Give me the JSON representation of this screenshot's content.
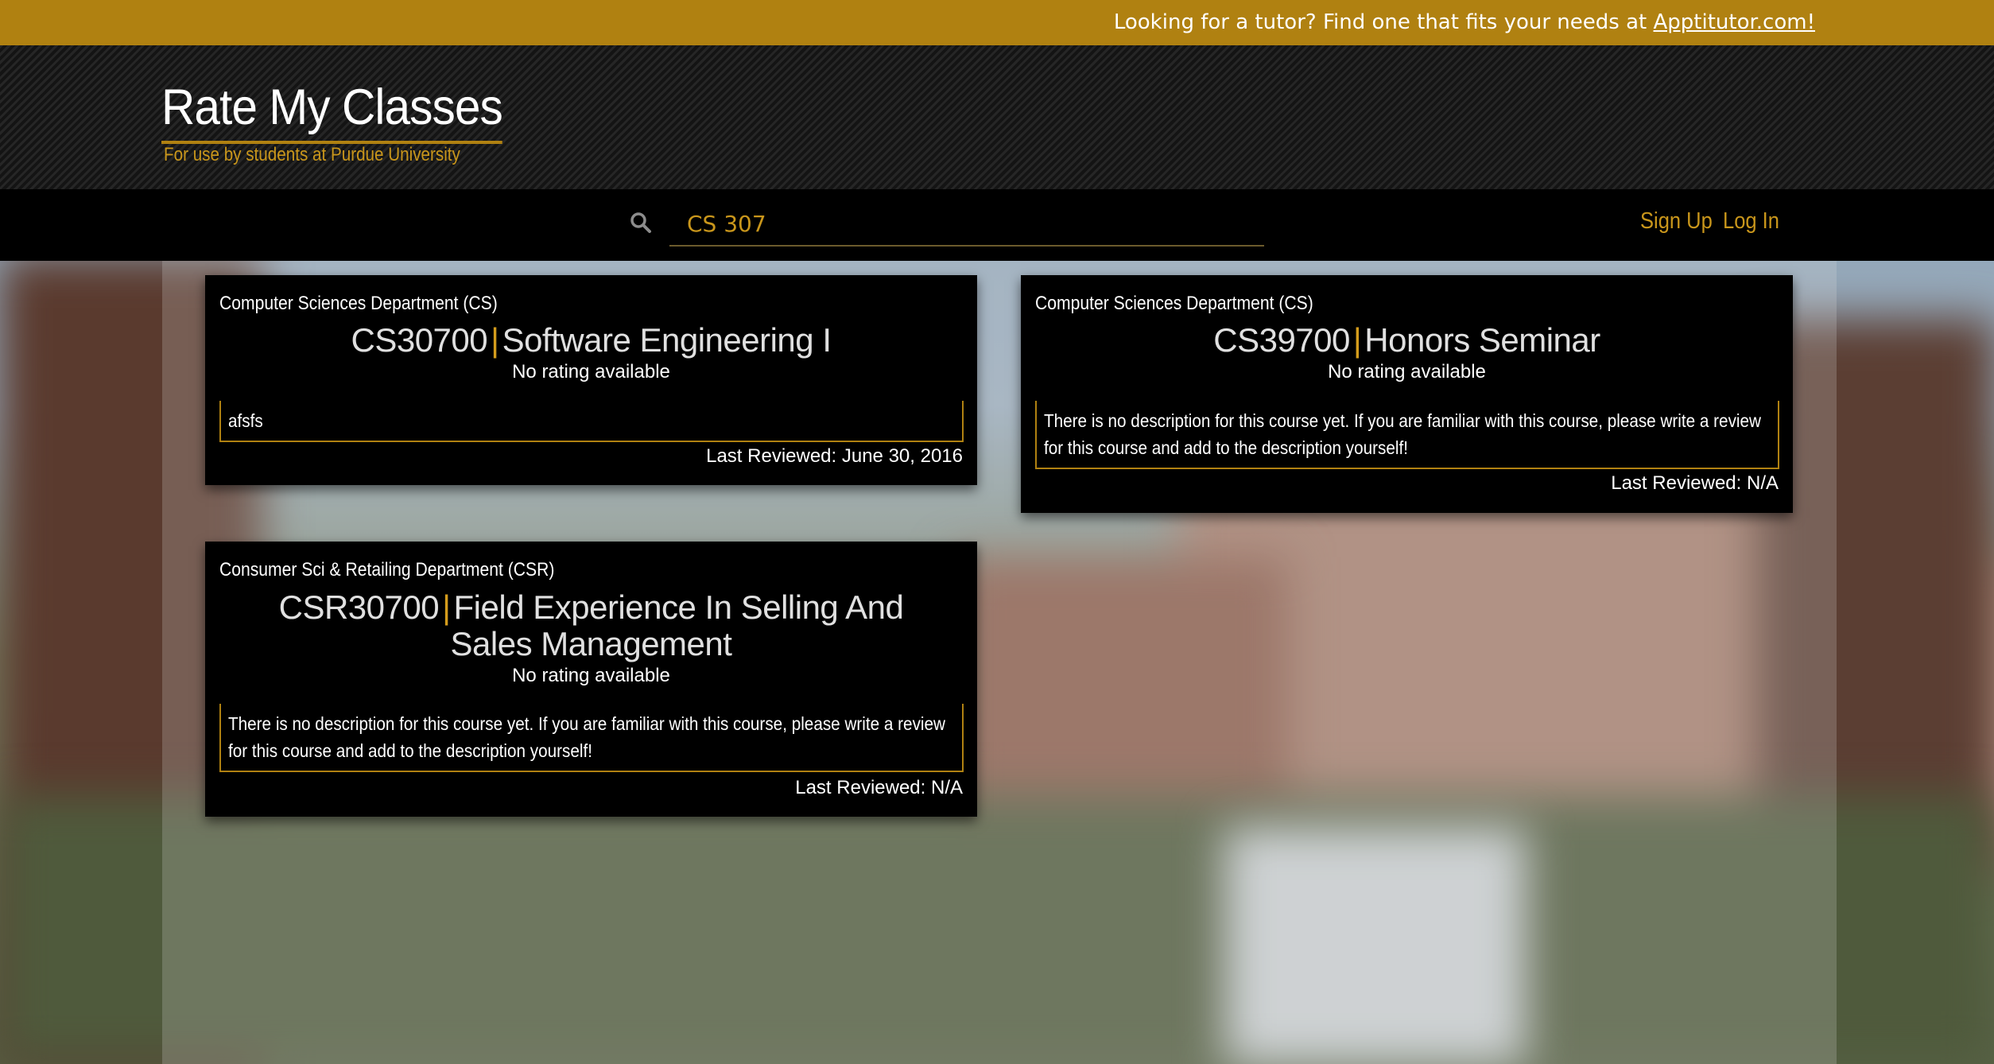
{
  "announcement": {
    "text": "Looking for a tutor? Find one that fits your needs at ",
    "link_text": "Apptitutor.com!"
  },
  "brand": {
    "title": "Rate My Classes",
    "subtitle": "For use by students at Purdue University"
  },
  "nav": {
    "search_value": "CS 307",
    "signup_label": "Sign Up",
    "login_label": "Log In"
  },
  "courses": [
    {
      "department": "Computer Sciences Department (CS)",
      "code": "CS30700",
      "separator": "|",
      "name": "Software Engineering I",
      "rating": "No rating available",
      "description": "afsfs",
      "last_reviewed": "Last Reviewed: June 30, 2016"
    },
    {
      "department": "Computer Sciences Department (CS)",
      "code": "CS39700",
      "separator": "|",
      "name": "Honors Seminar",
      "rating": "No rating available",
      "description": "There is no description for this course yet. If you are familiar with this course, please write a review for this course and add to the description yourself!",
      "last_reviewed": "Last Reviewed: N/A"
    },
    {
      "department": "Consumer Sci & Retailing Department (CSR)",
      "code": "CSR30700",
      "separator": "|",
      "name": "Field Experience In Selling And Sales Management",
      "rating": "No rating available",
      "description": "There is no description for this course yet. If you are familiar with this course, please write a review for this course and add to the description yourself!",
      "last_reviewed": "Last Reviewed: N/A"
    }
  ],
  "colors": {
    "accent": "#b08111",
    "accent_text": "#c9961b",
    "card_bg": "#000000"
  },
  "icons": {
    "search": "search-icon"
  }
}
